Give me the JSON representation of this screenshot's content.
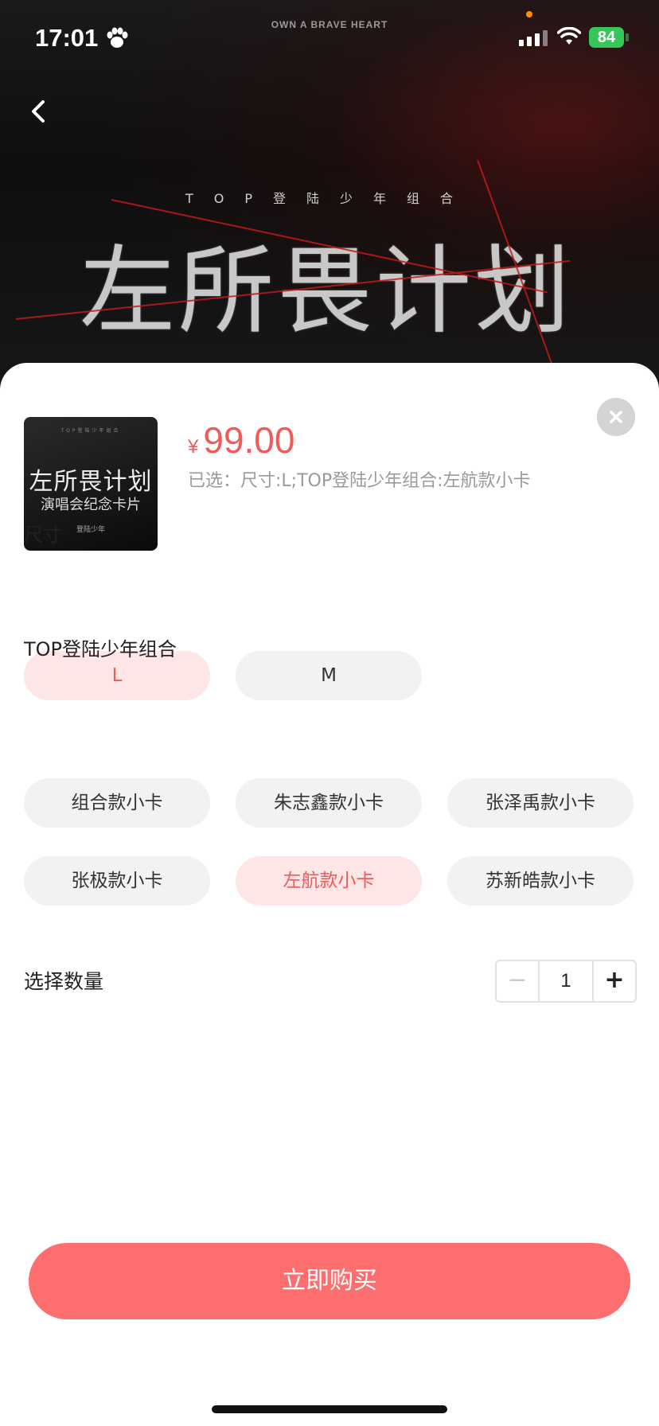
{
  "status_bar": {
    "time": "17:01",
    "battery": "84"
  },
  "banner": {
    "top_text": "OWN A BRAVE HEART",
    "subtitle": "TOP登陆少年组合",
    "title": "左所畏计划"
  },
  "thumbnail": {
    "small_text": "TOP登陆少年组合",
    "line1": "左所畏计划",
    "line2": "演唱会纪念卡片",
    "line3": "登陆少年"
  },
  "product": {
    "currency": "¥",
    "price": "99.00",
    "selected": "已选：尺寸:L;TOP登陆少年组合:左航款小卡"
  },
  "size": {
    "title": "尺寸",
    "options": [
      "L",
      "M"
    ],
    "selected": "L"
  },
  "group": {
    "title": "TOP登陆少年组合",
    "options": [
      "组合款小卡",
      "朱志鑫款小卡",
      "张泽禹款小卡",
      "张极款小卡",
      "左航款小卡",
      "苏新皓款小卡"
    ],
    "selected": "左航款小卡"
  },
  "quantity": {
    "label": "选择数量",
    "value": "1",
    "minus": "−",
    "plus": "+"
  },
  "buy_label": "立即购买",
  "colors": {
    "accent": "#f25a5a",
    "buy_button": "#ff6e6e",
    "chip_active_bg": "#ffe6e6",
    "chip_bg": "#f2f2f2"
  }
}
